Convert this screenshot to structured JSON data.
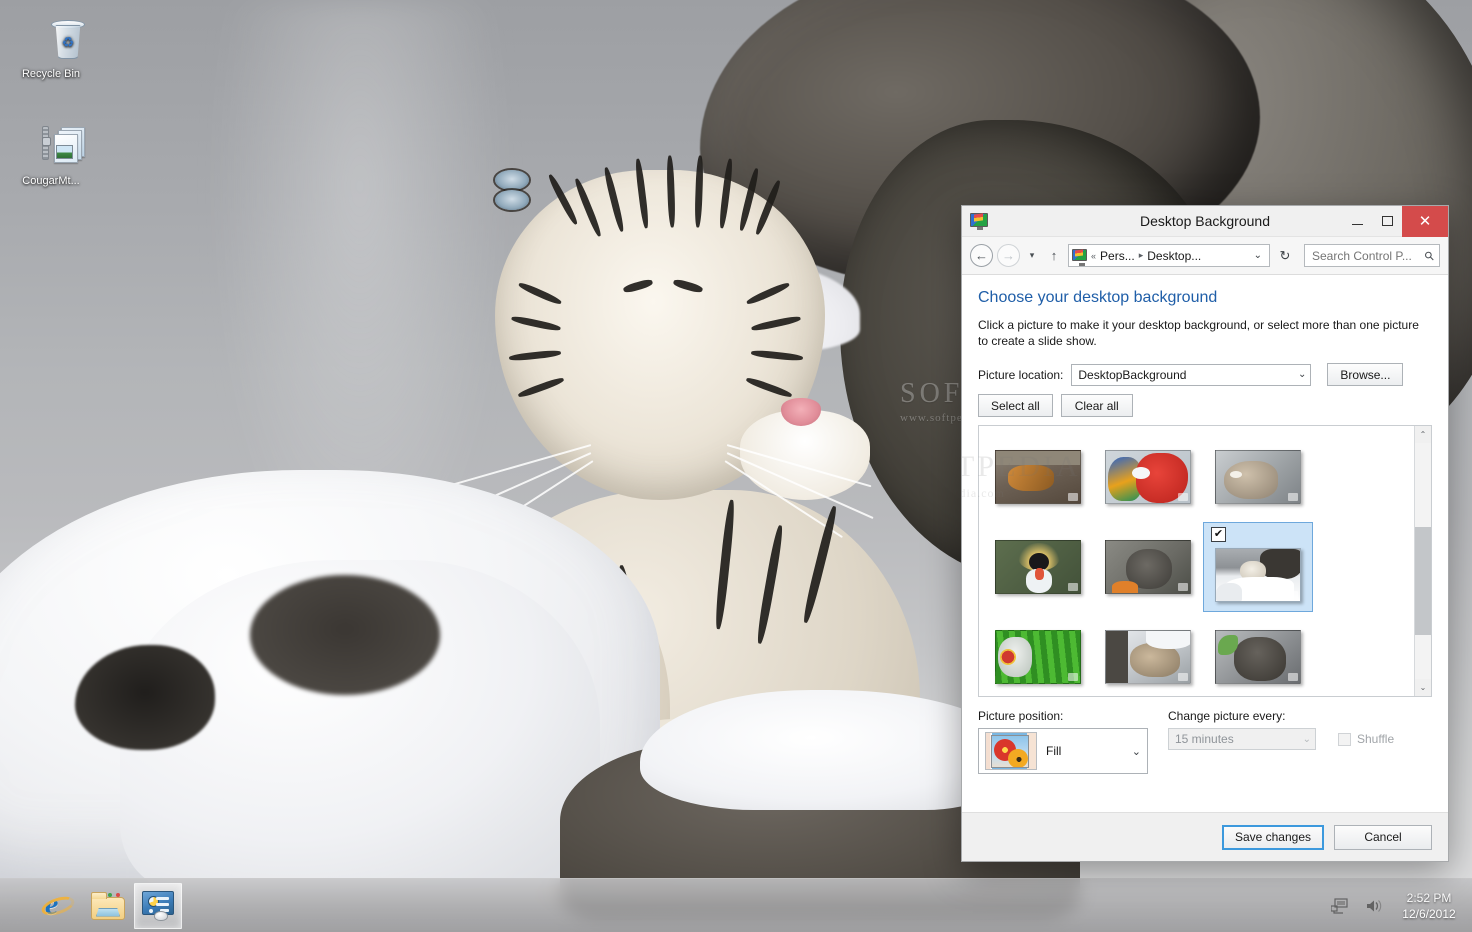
{
  "desktop": {
    "icons": [
      {
        "name": "Recycle Bin",
        "icon": "recycle-bin-icon"
      },
      {
        "name": "CougarMt...",
        "icon": "zip-archive-icon"
      }
    ],
    "wallpaper_watermark": {
      "line1": "SOFTPEDIA",
      "line2": "www.softpedia.com"
    }
  },
  "taskbar": {
    "buttons": [
      {
        "label": "Internet Explorer",
        "icon": "internet-explorer-icon",
        "active": false
      },
      {
        "label": "File Explorer",
        "icon": "file-explorer-icon",
        "active": false
      },
      {
        "label": "Control Panel",
        "icon": "control-panel-icon",
        "active": true
      }
    ],
    "tray": [
      {
        "label": "Network",
        "icon": "network-icon"
      },
      {
        "label": "Volume",
        "icon": "speaker-icon"
      }
    ],
    "clock": {
      "time": "2:52 PM",
      "date": "12/6/2012"
    }
  },
  "window": {
    "title": "Desktop Background",
    "app_icon": "personalization-monitor-icon",
    "controls": {
      "minimize": "–",
      "maximize": "□",
      "close": "✕"
    },
    "nav": {
      "back": "←",
      "forward": "→",
      "recent_caret": "▾",
      "up": "↑",
      "breadcrumbs": [
        {
          "label": "«",
          "type": "overflow"
        },
        {
          "label": "Pers...",
          "type": "crumb"
        },
        {
          "label": "▸",
          "type": "separator"
        },
        {
          "label": "Desktop...",
          "type": "crumb"
        }
      ],
      "address_caret": "⌄",
      "refresh": "↻",
      "address_icon": "personalization-monitor-icon"
    },
    "search": {
      "placeholder": "Search Control P...",
      "value": "",
      "icon": "search-icon"
    },
    "content": {
      "heading": "Choose your desktop background",
      "description": "Click a picture to make it your desktop background, or select more than one picture to create a slide show.",
      "picture_location_label": "Picture location:",
      "picture_location_value": "DesktopBackground",
      "browse_button": "Browse...",
      "select_all_button": "Select all",
      "clear_all_button": "Clear all",
      "watermark": {
        "line1": "SOFTPEDIA",
        "line2": "www.softpedia.com"
      }
    },
    "thumbnails": [
      {
        "name": "tiger-on-rocks",
        "selected": false,
        "checked": false
      },
      {
        "name": "macaws-red-and-blue",
        "selected": false,
        "checked": false
      },
      {
        "name": "cougar-profile",
        "selected": false,
        "checked": false
      },
      {
        "name": "crowned-crane",
        "selected": false,
        "checked": false
      },
      {
        "name": "wallaby-grey",
        "selected": false,
        "checked": false
      },
      {
        "name": "white-tiger-in-snow",
        "selected": true,
        "checked": true
      },
      {
        "name": "green-parrot-foliage",
        "selected": false,
        "checked": false
      },
      {
        "name": "cougar-in-snow",
        "selected": false,
        "checked": false
      },
      {
        "name": "wallaby-closeup",
        "selected": false,
        "checked": false
      },
      {
        "name": "cougar-cub-on-rocks",
        "selected": false,
        "checked": false
      },
      {
        "name": "hyacinth-macaw",
        "selected": false,
        "checked": false
      },
      {
        "name": "cougar-face",
        "selected": false,
        "checked": false
      }
    ],
    "scrollbar": {
      "up_arrow": "⌃",
      "down_arrow": "⌄"
    },
    "options": {
      "picture_position_label": "Picture position:",
      "picture_position_value": "Fill",
      "picture_position_caret": "⌄",
      "change_picture_label": "Change picture every:",
      "change_picture_value": "15 minutes",
      "change_picture_caret": "⌄",
      "shuffle_label": "Shuffle",
      "shuffle_checked": false
    },
    "footer": {
      "save_button": "Save changes",
      "cancel_button": "Cancel"
    }
  },
  "colors": {
    "accent_blue": "#1f5ea8",
    "selection_blue": "#cce3f7",
    "selection_border": "#6ea8dc",
    "close_red": "#d44b4b",
    "focus_border": "#3c99dd"
  }
}
